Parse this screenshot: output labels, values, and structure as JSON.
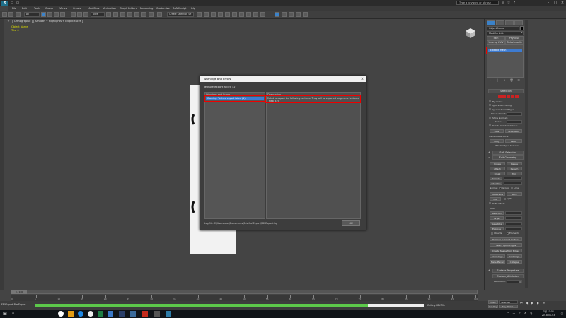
{
  "window": {
    "app_logo": "S",
    "search_placeholder": "Type a keyword or phrase"
  },
  "menu": [
    "File",
    "Edit",
    "Tools",
    "Group",
    "Views",
    "Create",
    "Modifiers",
    "Animation",
    "Graph Editors",
    "Rendering",
    "Customize",
    "MAXScript",
    "Help"
  ],
  "toolbar": {
    "selection_filter": "All",
    "reference_coord": "View",
    "named_selection": "Create Selection Se"
  },
  "viewport": {
    "label": "[ + ] [ Orthographic ] [ Smooth + Highlights + Edged Faces ]",
    "object_label": "Object Name",
    "tris_label": "Tris:",
    "tris_value": "0"
  },
  "dialog": {
    "title": "Warnings and Errors",
    "header": "Texture export failed (1)",
    "warnings_title": "Warnings and Errors",
    "warning_item": "Warning: Texture export failed (1)",
    "description_title": "Description",
    "description_line1": "Failed to export the following textures. They will be exported as generic textures.",
    "description_line2": "Map #29",
    "log_path": "Log file: C:\\Users\\user\\Documents\\3dsMax\\Export\\FBXExport.log",
    "ok_label": "OK"
  },
  "command_panel": {
    "object_name": "Object Name",
    "modifier_list": "Modifier List",
    "btn_skin": "Skin",
    "btn_physique": "Physique",
    "btn_unwrap": "Unwrap UVW",
    "btn_turbosmooth": "TurboSmooth",
    "stack_item": "Editable Mesh",
    "selection_title": "Selection",
    "by_vertex": "By Vertex",
    "ignore_backfacing": "Ignore Backfacing",
    "ignore_visible_edges": "Ignore Visible Edges",
    "planar_thresh": "Planar Thresh:",
    "show_normals": "Show Normals",
    "scale": "Scale:",
    "delete_isolated": "Delete Isolated Vertices",
    "hide": "Hide",
    "unhide_all": "Unhide All",
    "named_selections": "Named Selections:",
    "copy": "Copy",
    "paste": "Paste",
    "whole_object_selected": "Whole Object Selected",
    "soft_selection": "Soft Selection",
    "edit_geometry": "Edit Geometry",
    "create": "Create",
    "delete": "Delete",
    "attach": "Attach",
    "detach": "Detach",
    "break": "Break",
    "turn": "Turn",
    "extrude": "Extrude",
    "chamfer": "Chamfer",
    "normal": "Normal:",
    "group": "Group",
    "local": "Local",
    "slice_plane": "Slice Plane",
    "slice": "Slice",
    "cut": "Cut",
    "split": "Split",
    "refine_ends": "Refine Ends",
    "weld": "Weld",
    "selected": "Selected",
    "target": "Target",
    "tessellate": "Tessellate",
    "explode": "Explode",
    "to_objects": "Objects",
    "elements": "Elements",
    "remove_isolated": "Remove Isolated Vertices",
    "select_open_edges": "Select Open Edges",
    "create_shape": "Create Shape from Edges",
    "view_align": "View Align",
    "grid_align": "Grid Align",
    "make_planar": "Make Planar",
    "collapse": "Collapse",
    "surface_properties": "Surface Properties",
    "custom_attributes": "Custom_Attributes",
    "resolution_label": "Resolution:",
    "resolution_value": "0"
  },
  "timeline": {
    "thumb": "0 / 100",
    "ticks": [
      "0",
      "5",
      "10",
      "15",
      "20",
      "25",
      "30",
      "35",
      "40",
      "45",
      "50",
      "55",
      "60",
      "65",
      "70",
      "75",
      "80",
      "85",
      "90",
      "95",
      "100"
    ]
  },
  "status": {
    "left": "FBXExport File Export",
    "progress_fraction": 0.855,
    "right": "Writing FBX File",
    "auto_key": "Auto Key",
    "set_key": "Set Key",
    "selected": "Selected",
    "key_filters": "Key Filters..."
  },
  "taskbar": {
    "time": "오전 11:51",
    "date": "2018-01-03"
  }
}
